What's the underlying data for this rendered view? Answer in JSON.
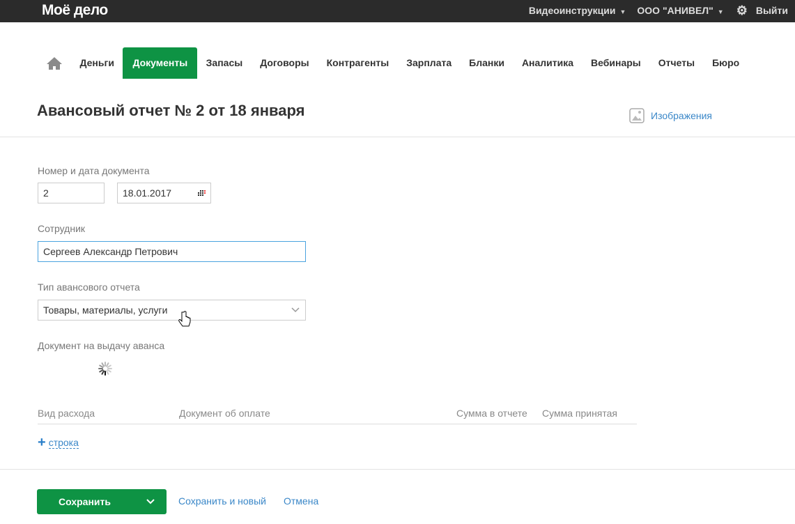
{
  "header": {
    "logo": "Моё дело",
    "video": "Видеоинструкции",
    "company": "ООО \"АНИВЕЛ\"",
    "logout": "Выйти"
  },
  "nav": {
    "items": [
      "Деньги",
      "Документы",
      "Запасы",
      "Договоры",
      "Контрагенты",
      "Зарплата",
      "Бланки",
      "Аналитика",
      "Вебинары",
      "Отчеты",
      "Бюро"
    ],
    "active": "Документы"
  },
  "page": {
    "title": "Авансовый отчет № 2 от 18 января",
    "images_link": "Изображения"
  },
  "form": {
    "number_date_label": "Номер и дата документа",
    "number": "2",
    "date": "18.01.2017",
    "employee_label": "Сотрудник",
    "employee": "Сергеев Александр Петрович",
    "type_label": "Тип авансового отчета",
    "type": "Товары, материалы, услуги",
    "advance_doc_label": "Документ на выдачу аванса"
  },
  "table": {
    "headers": [
      "Вид расхода",
      "Документ об оплате",
      "Сумма в отчете",
      "Сумма принятая"
    ],
    "add_row": "строка"
  },
  "footer": {
    "save": "Сохранить",
    "save_new": "Сохранить и новый",
    "cancel": "Отмена"
  },
  "colors": {
    "brand_green": "#0e9344",
    "link_blue": "#3a87c8",
    "topbar": "#2b2b2b"
  }
}
